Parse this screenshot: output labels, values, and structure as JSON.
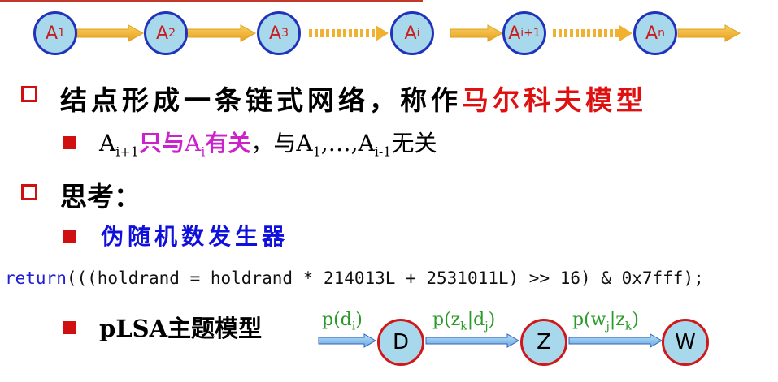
{
  "chain": {
    "nodes": [
      {
        "base": "A",
        "sub": "1"
      },
      {
        "base": "A",
        "sub": "2"
      },
      {
        "base": "A",
        "sub": "3"
      },
      {
        "base": "A",
        "sub": "i"
      },
      {
        "base": "A",
        "sub": "i+1"
      },
      {
        "base": "A",
        "sub": "n"
      }
    ]
  },
  "bullets": {
    "b1_prefix": "结点形成一条链式网络，称作",
    "b1_highlight": "马尔科夫模型",
    "b1a": {
      "a_sub1": "i+1",
      "purple_text1": "只与",
      "a_sub2": "i",
      "purple_text2": "有关",
      "rest_prefix": "，与A",
      "sub_1": "1",
      "mid": ",…,A",
      "sub_im1": "i-1",
      "rest_suffix": "无关",
      "a_letter": "A"
    },
    "b2": "思考：",
    "b2a": "伪随机数发生器",
    "code_kw": "return",
    "code_rest": "(((holdrand = holdrand * 214013L + 2531011L) >> 16) & 0x7fff);",
    "b2b": "pLSA主题模型"
  },
  "plsa": {
    "nodes": [
      "D",
      "Z",
      "W"
    ],
    "label1": {
      "base": "p(d",
      "sub": "i",
      "end": ")"
    },
    "label2": {
      "base": "p(z",
      "sub1": "k",
      "mid": "|d",
      "sub2": "j",
      "end": ")"
    },
    "label3": {
      "base": "p(w",
      "sub1": "j",
      "mid": "|z",
      "sub2": "k",
      "end": ")"
    }
  },
  "colors": {
    "accent_red": "#e01010",
    "purple": "#cc22cc",
    "blue": "#1010dd",
    "green": "#2a9a2a",
    "node_fill": "#a8d8ec"
  }
}
